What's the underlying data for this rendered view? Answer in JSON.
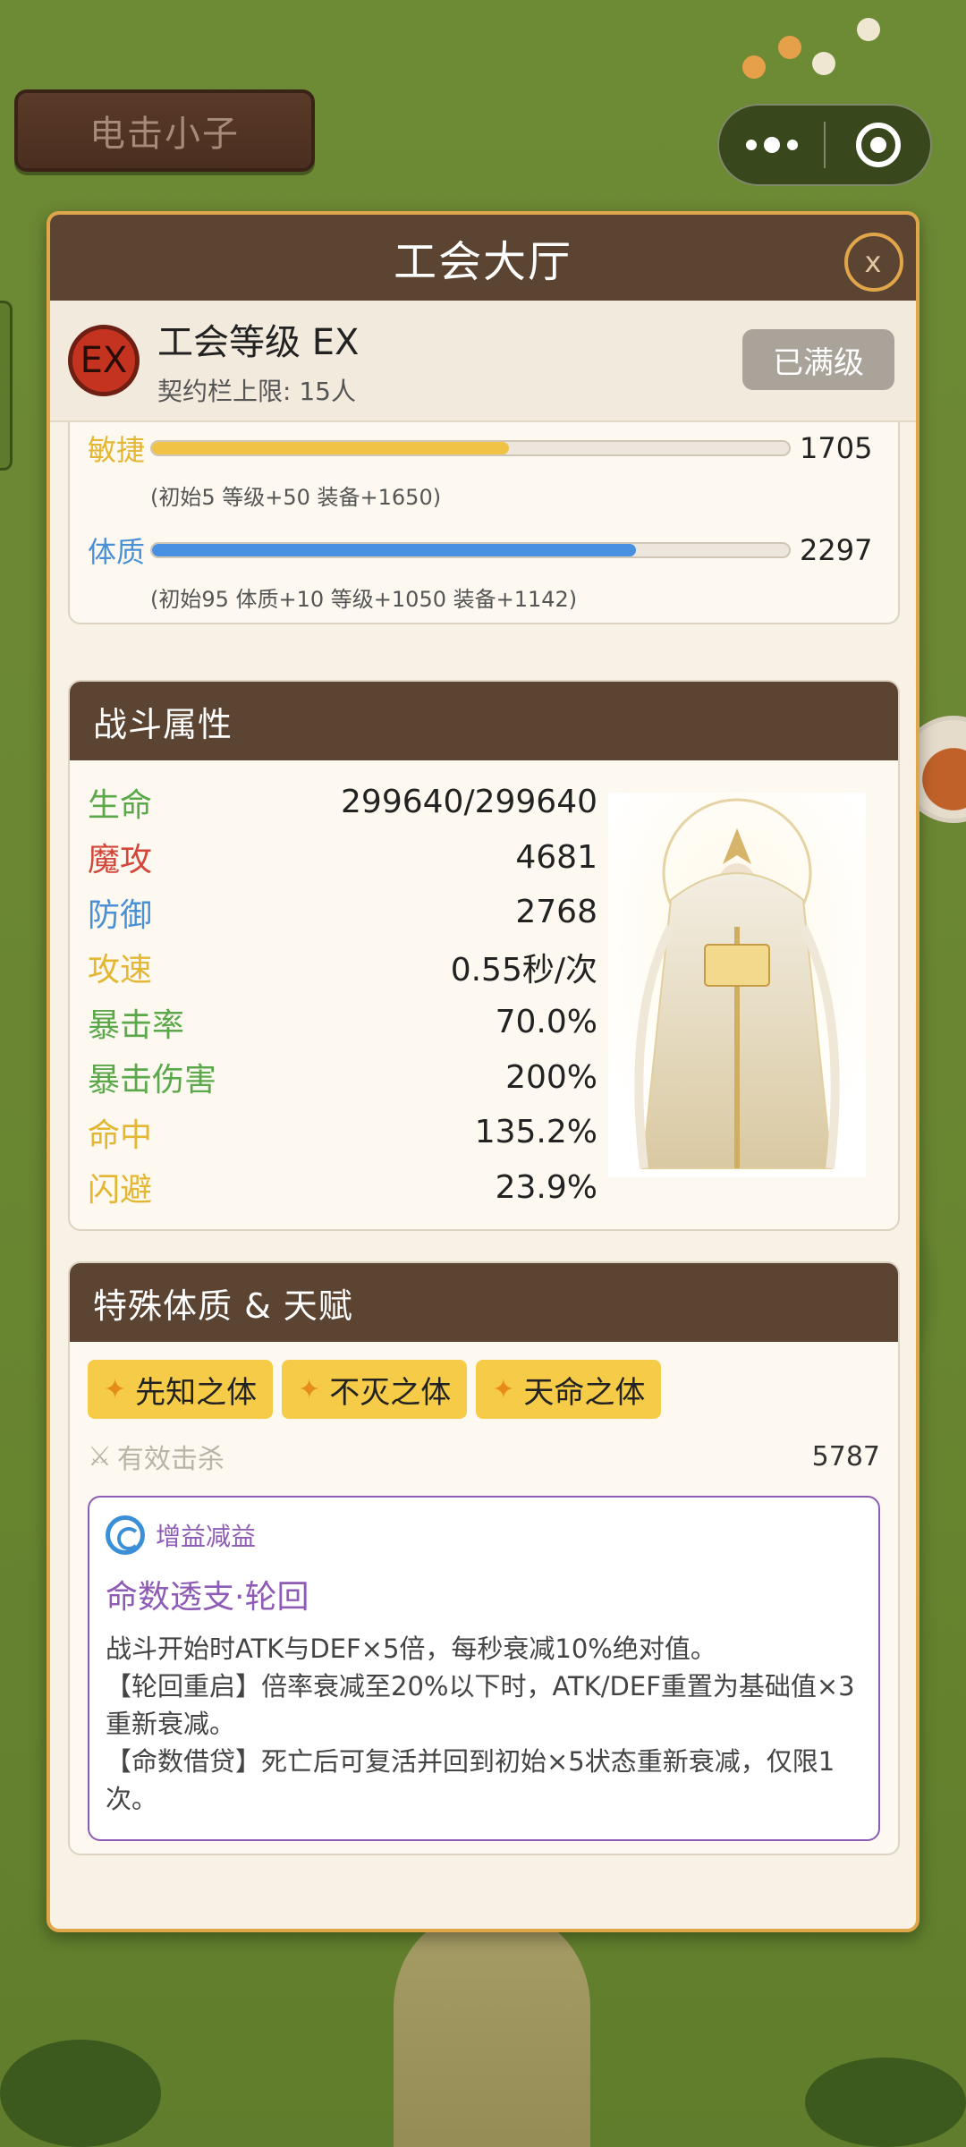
{
  "header": {
    "player_name": "电击小子"
  },
  "panel": {
    "title": "工会大厅",
    "close_label": "x",
    "guild": {
      "badge": "EX",
      "level_label": "工会等级 EX",
      "limit_label": "契约栏上限: 15人",
      "max_button": "已满级"
    }
  },
  "attributes": [
    {
      "name": "敏捷",
      "value": "1705",
      "ratio": 0.56,
      "color": "#f0c245",
      "detail": "(初始5 等级+50 装备+1650)"
    },
    {
      "name": "体质",
      "value": "2297",
      "ratio": 0.76,
      "color": "#4a90e2",
      "detail": "(初始95 体质+10 等级+1050 装备+1142)"
    }
  ],
  "combat": {
    "title": "战斗属性",
    "stats": [
      {
        "name": "生命",
        "value": "299640/299640",
        "color": "#5aa84a"
      },
      {
        "name": "魔攻",
        "value": "4681",
        "color": "#d2473a"
      },
      {
        "name": "防御",
        "value": "2768",
        "color": "#4a90d6"
      },
      {
        "name": "攻速",
        "value": "0.55秒/次",
        "color": "#e3b733"
      },
      {
        "name": "暴击率",
        "value": "70.0%",
        "color": "#5aa84a"
      },
      {
        "name": "暴击伤害",
        "value": "200%",
        "color": "#5aa84a"
      },
      {
        "name": "命中",
        "value": "135.2%",
        "color": "#e3b733"
      },
      {
        "name": "闪避",
        "value": "23.9%",
        "color": "#e3b733"
      }
    ]
  },
  "special": {
    "title": "特殊体质 & 天赋",
    "talents": [
      "先知之体",
      "不灭之体",
      "天命之体"
    ],
    "kills_label": "有效击杀",
    "kills_value": "5787",
    "buff": {
      "tag": "增益减益",
      "name": "命数透支·轮回",
      "description": "战斗开始时ATK与DEF×5倍，每秒衰减10%绝对值。\n【轮回重启】倍率衰减至20%以下时，ATK/DEF重置为基础值×3重新衰减。\n【命数借贷】死亡后可复活并回到初始×5状态重新衰减，仅限1次。"
    }
  }
}
